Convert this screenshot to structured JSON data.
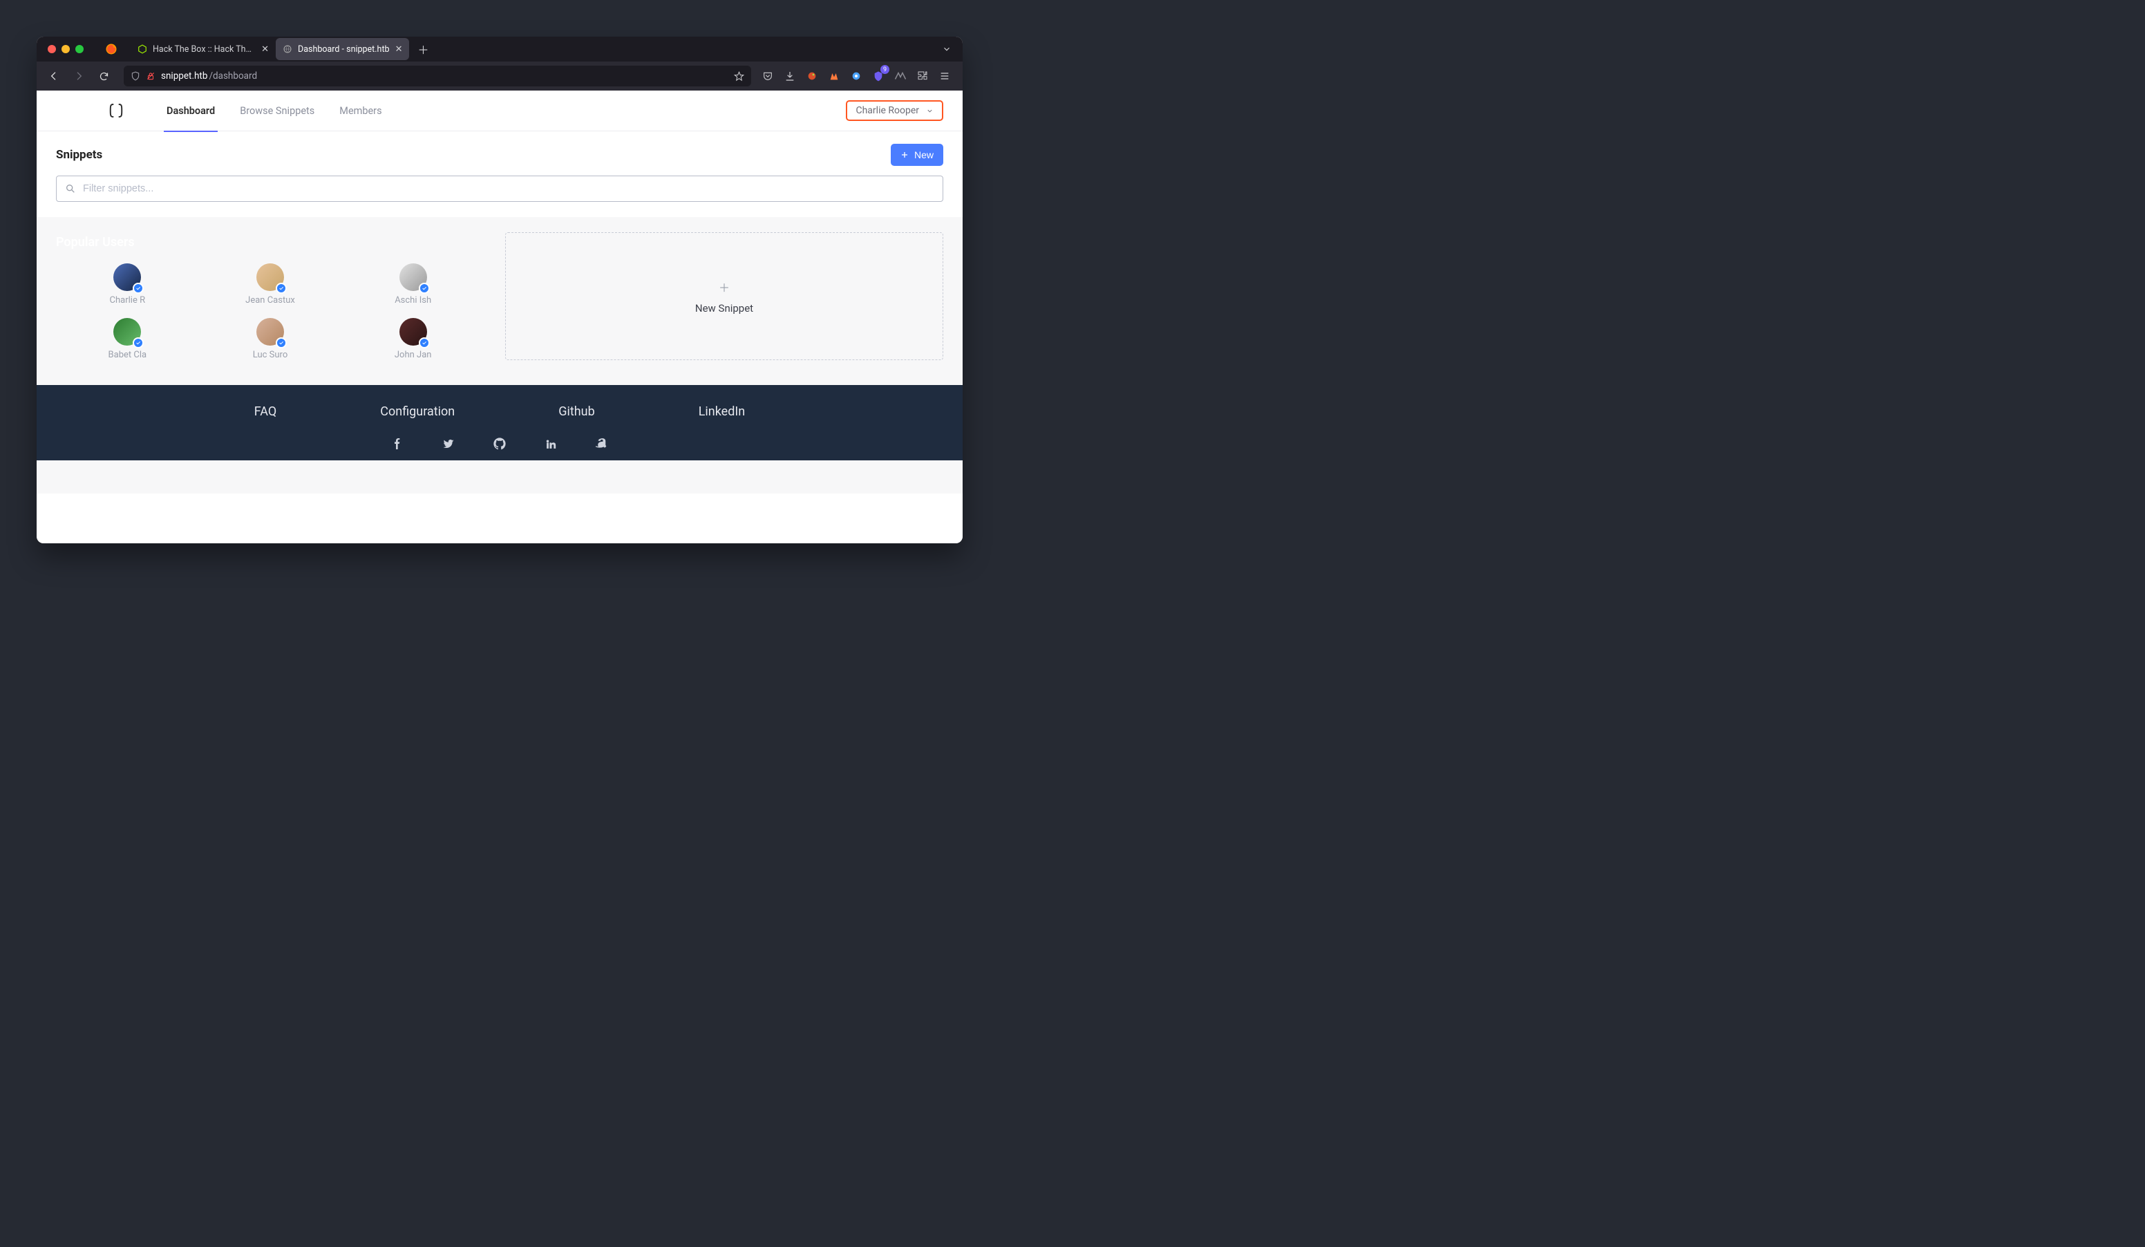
{
  "browser": {
    "tabs": [
      {
        "label": "Hack The Box :: Hack The Box",
        "active": false
      },
      {
        "label": "Dashboard - snippet.htb",
        "active": true
      }
    ],
    "url_host": "snippet.htb",
    "url_path": "/dashboard",
    "ext_badge": "9"
  },
  "nav": {
    "items": [
      "Dashboard",
      "Browse Snippets",
      "Members"
    ],
    "active_index": 0,
    "user_name": "Charlie Rooper"
  },
  "snippets": {
    "heading": "Snippets",
    "new_btn": "New",
    "filter_placeholder": "Filter snippets..."
  },
  "popular": {
    "title": "Popular Users",
    "users": [
      {
        "name": "Charlie R",
        "grad": [
          "#4b6cb7",
          "#182848"
        ]
      },
      {
        "name": "Jean Castux",
        "grad": [
          "#e6c29a",
          "#c9a66b"
        ]
      },
      {
        "name": "Aschi Ish",
        "grad": [
          "#e0e0e0",
          "#9a9a9a"
        ]
      },
      {
        "name": "Babet Cla",
        "grad": [
          "#2e7d32",
          "#66bb6a"
        ]
      },
      {
        "name": "Luc Suro",
        "grad": [
          "#d7b19a",
          "#b58863"
        ]
      },
      {
        "name": "John Jan",
        "grad": [
          "#5a2a2a",
          "#2a1414"
        ]
      }
    ]
  },
  "new_snippet_label": "New Snippet",
  "footer": {
    "links": [
      "FAQ",
      "Configuration",
      "Github",
      "LinkedIn"
    ]
  },
  "colors": {
    "accent_blue": "#4a7dff",
    "highlight_box": "#ff5722"
  }
}
